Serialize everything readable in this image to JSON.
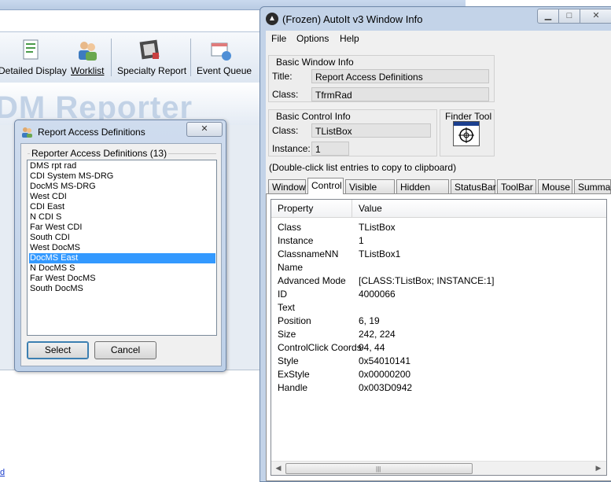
{
  "background_app": {
    "toolbar": [
      {
        "label": "Detailed Display",
        "icon": "detailed-display-icon"
      },
      {
        "label": "Worklist",
        "icon": "worklist-icon"
      },
      {
        "label": "Specialty Report",
        "icon": "specialty-report-icon"
      },
      {
        "label": "Event Queue",
        "icon": "event-queue-icon"
      }
    ],
    "banner": "DM Reporter",
    "link": "d"
  },
  "rad_dialog": {
    "title": "Report Access Definitions",
    "close_label": "✕",
    "group_label": "Reporter Access Definitions (13)",
    "items": [
      "DMS rpt rad",
      "CDI System MS-DRG",
      "DocMS MS-DRG",
      "West CDI",
      "CDI East",
      "N CDI S",
      "Far West CDI",
      "South CDI",
      "West DocMS",
      "DocMS East",
      "N DocMS S",
      "Far West DocMS",
      "South DocMS"
    ],
    "selected": "DocMS East",
    "select_label": "Select",
    "cancel_label": "Cancel"
  },
  "autoit": {
    "title": "(Frozen) AutoIt v3 Window Info",
    "menu": [
      "File",
      "Options",
      "Help"
    ],
    "basic_window": {
      "group_title": "Basic Window Info",
      "title_label": "Title:",
      "title_value": "Report Access Definitions",
      "class_label": "Class:",
      "class_value": "TfrmRad"
    },
    "basic_control": {
      "group_title": "Basic Control Info",
      "class_label": "Class:",
      "class_value": "TListBox",
      "instance_label": "Instance:",
      "instance_value": "1"
    },
    "finder_tool_label": "Finder Tool",
    "hint": "(Double-click list entries to copy to clipboard)",
    "tabs": [
      "Window",
      "Control",
      "Visible Text",
      "Hidden Text",
      "StatusBar",
      "ToolBar",
      "Mouse",
      "Summary"
    ],
    "active_tab": "Control",
    "columns": {
      "property": "Property",
      "value": "Value"
    },
    "rows": [
      {
        "property": "Class",
        "value": "TListBox"
      },
      {
        "property": "Instance",
        "value": "1"
      },
      {
        "property": "ClassnameNN",
        "value": "TListBox1"
      },
      {
        "property": "Name",
        "value": ""
      },
      {
        "property": "Advanced Mode",
        "value": "[CLASS:TListBox; INSTANCE:1]"
      },
      {
        "property": "ID",
        "value": "4000066"
      },
      {
        "property": "Text",
        "value": ""
      },
      {
        "property": "Position",
        "value": "6, 19"
      },
      {
        "property": "Size",
        "value": "242, 224"
      },
      {
        "property": "ControlClick Coords",
        "value": "94, 44"
      },
      {
        "property": "Style",
        "value": "0x54010141"
      },
      {
        "property": "ExStyle",
        "value": "0x00000200"
      },
      {
        "property": "Handle",
        "value": "0x003D0942"
      }
    ],
    "colors": {
      "title_bar": "#c3d3e8",
      "selection": "#3399ff"
    }
  }
}
